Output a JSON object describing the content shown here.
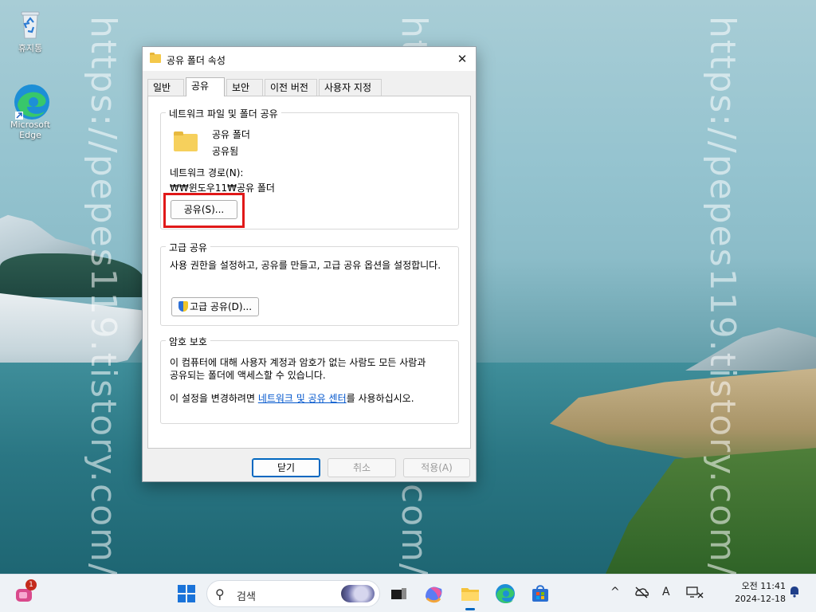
{
  "desktop": {
    "icons": [
      {
        "label": "휴지통"
      },
      {
        "label": "Microsoft Edge"
      }
    ],
    "watermark": "https://pepes119.tistory.com/"
  },
  "dialog": {
    "title": "공유 폴더 속성",
    "close_glyph": "✕",
    "tabs": [
      "일반",
      "공유",
      "보안",
      "이전 버전",
      "사용자 지정"
    ],
    "active_tab": "공유",
    "network_share": {
      "legend": "네트워크 파일 및 폴더 공유",
      "folder_name": "공유 폴더",
      "status": "공유됨",
      "path_label": "네트워크 경로(N):",
      "path_value": "₩₩윈도우11₩공유 폴더",
      "share_button": "공유(S)...",
      "highlight_color": "#e01818"
    },
    "advanced_share": {
      "legend": "고급 공유",
      "description": "사용 권한을 설정하고, 공유를 만들고, 고급 공유 옵션을 설정합니다.",
      "button": "고급 공유(D)..."
    },
    "password_protection": {
      "legend": "암호 보호",
      "description_line1": "이 컴퓨터에 대해 사용자 계정과 암호가 없는 사람도 모든 사람과",
      "description_line2": "공유되는 폴더에 액세스할 수 있습니다.",
      "change_prefix": "이 설정을 변경하려면 ",
      "change_link": "네트워크 및 공유 센터",
      "change_suffix": "를 사용하십시오."
    },
    "footer": {
      "close": "닫기",
      "cancel": "취소",
      "apply": "적용(A)"
    }
  },
  "taskbar": {
    "chat_badge": "1",
    "search_placeholder": "검색",
    "clock_time": "오전 11:41",
    "clock_date": "2024-12-18",
    "tray": {
      "chevron": "^",
      "ime": "A"
    }
  }
}
